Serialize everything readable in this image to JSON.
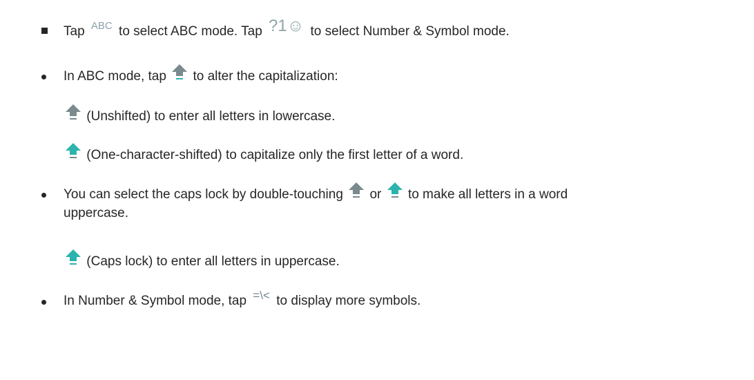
{
  "colors": {
    "text": "#262626",
    "shift_gray": "#7a8a8e",
    "shift_teal": "#2bb3ad",
    "key_text": "#8fa3aa"
  },
  "icons": {
    "abc_key": "ABC",
    "symbol_key": "?1☺",
    "more_symbols_key": "=\\<",
    "shift": "shift-arrow-icon"
  },
  "items": {
    "tap": "Tap",
    "abc_mode_text": "to select ABC mode. Tap",
    "symbol_mode_text": "to select Number & Symbol mode.",
    "abc_mode_prefix": "In ABC mode, tap",
    "abc_mode_suffix": "to alter the capitalization:",
    "unshifted": "(Unshifted) to enter all letters in lowercase.",
    "one_char_shifted": "(One-character-shifted) to capitalize only the first letter of a word.",
    "caps_prefix": "You can select the caps lock by double-touching",
    "caps_or": "or",
    "caps_suffix": "to make all letters in a word",
    "caps_suffix_2": "uppercase.",
    "caps_lock": "(Caps lock) to enter all letters in uppercase.",
    "number_mode_prefix": "In Number & Symbol mode, tap",
    "number_mode_suffix": "to display more symbols."
  }
}
